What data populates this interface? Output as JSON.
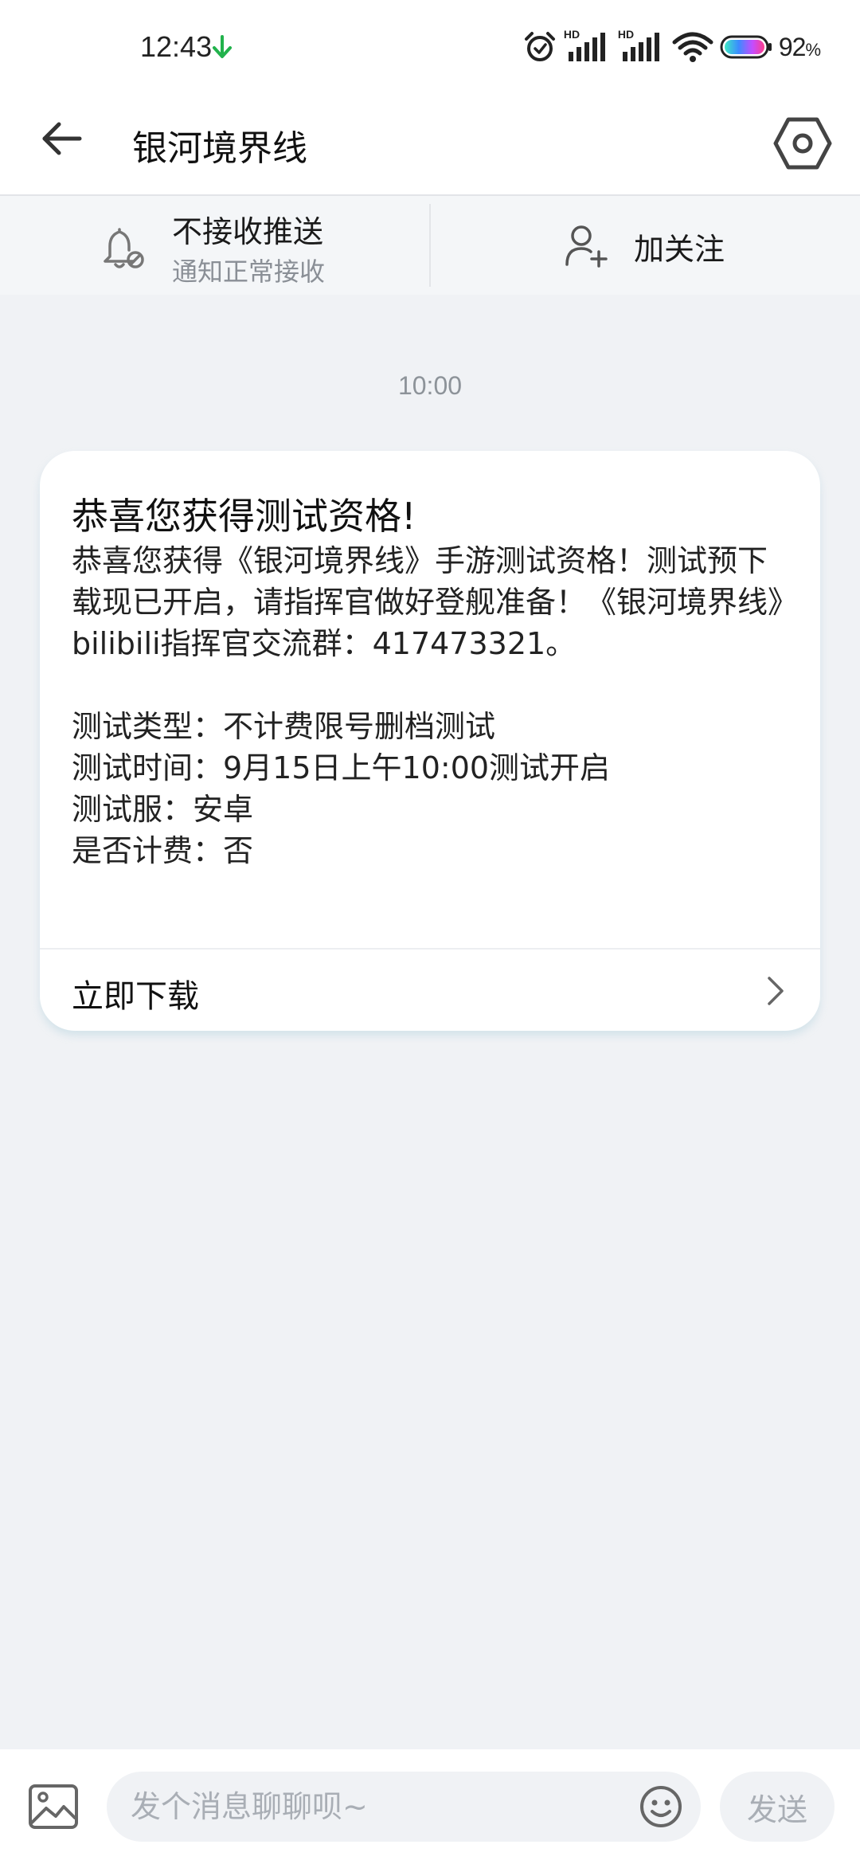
{
  "status_bar": {
    "time": "12:43",
    "download_icon": "download-arrow-icon",
    "hd_label_1": "HD",
    "hd_label_2": "HD",
    "battery_percent": "92",
    "percent_sign": "%",
    "download_color": "#22b24c"
  },
  "header": {
    "title": "银河境界线",
    "back_icon": "arrow-left-icon",
    "settings_icon": "hexagon-settings-icon"
  },
  "actions": {
    "mute_title": "不接收推送",
    "mute_subtitle": "通知正常接收",
    "follow_label": "加关注"
  },
  "conversation": {
    "timestamp": "10:00",
    "card": {
      "title": "恭喜您获得测试资格!",
      "intro": "恭喜您获得《银河境界线》手游测试资格！测试预下载现已开启，请指挥官做好登舰准备！《银河境界线》bilibili指挥官交流群：417473321。",
      "details": [
        "测试类型：不计费限号删档测试",
        "测试时间：9月15日上午10:00测试开启",
        "测试服：安卓",
        "是否计费：否"
      ],
      "action_label": "立即下载"
    }
  },
  "composer": {
    "placeholder": "发个消息聊聊呗~",
    "value": "",
    "send_label": "发送"
  }
}
